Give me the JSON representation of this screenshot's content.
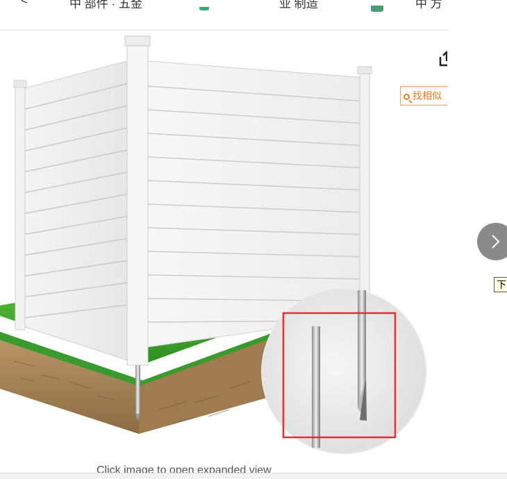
{
  "nav": {
    "clipped_labels": [
      "<",
      "中 部件 · 五金",
      "业 制造",
      "中 方"
    ]
  },
  "product": {
    "similar_button_label": "找相似",
    "next_label": "下",
    "expand_hint": "Click image to open expanded view"
  },
  "colors": {
    "accent_orange": "#f07a1e",
    "highlight_red": "#e03030",
    "grass_green": "#3faa32",
    "nav_circle": "#8a8a8a"
  }
}
